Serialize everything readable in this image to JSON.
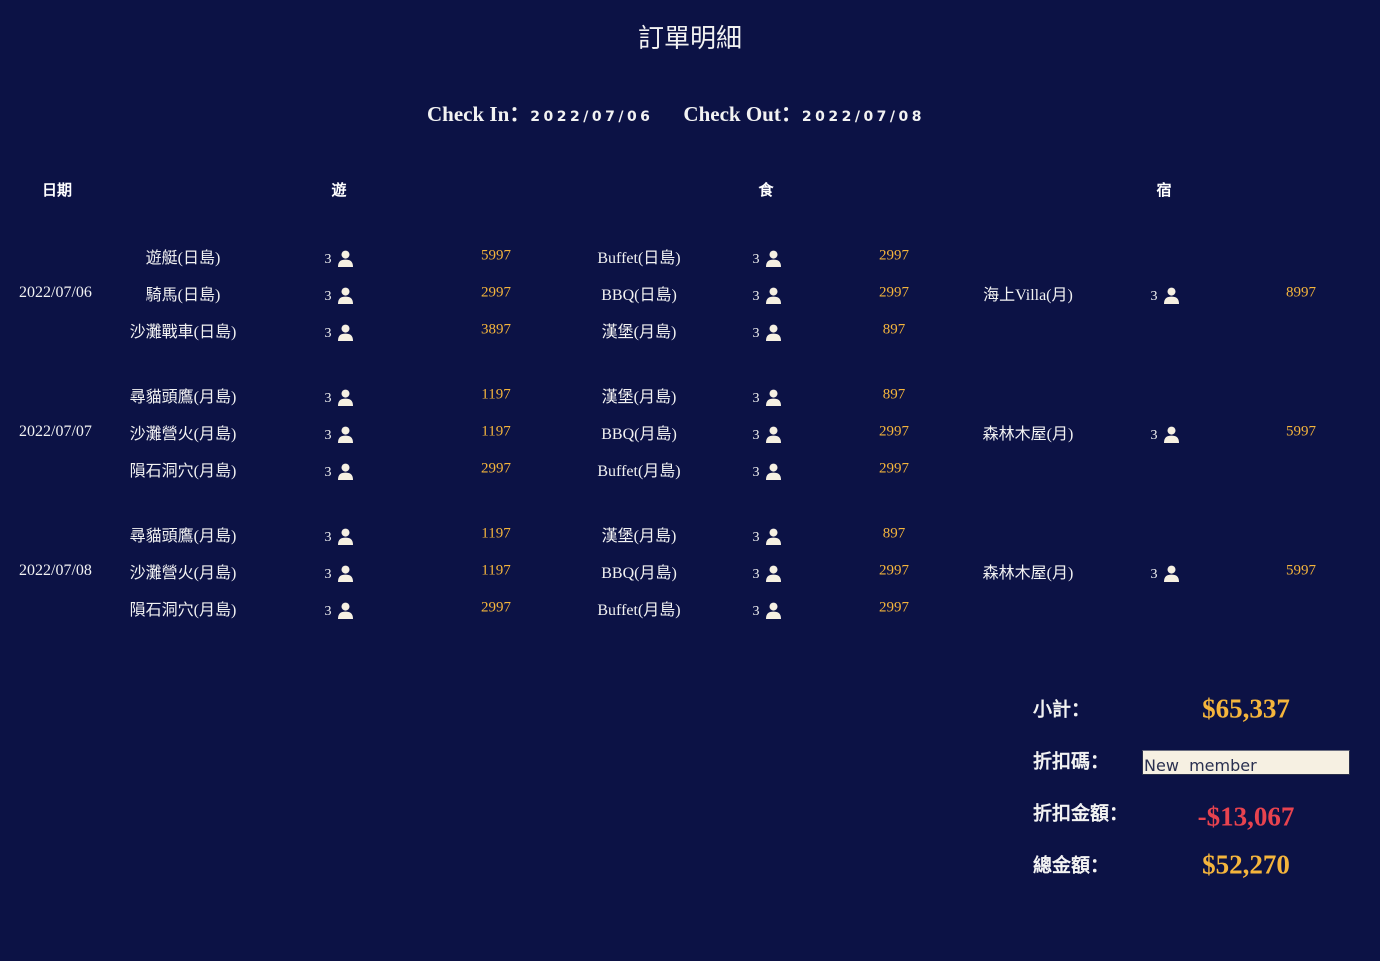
{
  "title": "訂單明細",
  "check_in": {
    "label": "Check In：",
    "value": "2022/07/06"
  },
  "check_out": {
    "label": "Check Out：",
    "value": "2022/07/08"
  },
  "headers": {
    "date": "日期",
    "play": "遊",
    "food": "食",
    "stay": "宿"
  },
  "days": [
    {
      "date": "2022/07/06",
      "play": [
        {
          "name": "遊艇(日島)",
          "qty": "3",
          "price": "5997"
        },
        {
          "name": "騎馬(日島)",
          "qty": "3",
          "price": "2997"
        },
        {
          "name": "沙灘戰車(日島)",
          "qty": "3",
          "price": "3897"
        }
      ],
      "food": [
        {
          "name": "Buffet(日島)",
          "qty": "3",
          "price": "2997"
        },
        {
          "name": "BBQ(日島)",
          "qty": "3",
          "price": "2997"
        },
        {
          "name": "漢堡(月島)",
          "qty": "3",
          "price": "897"
        }
      ],
      "stay": {
        "name": "海上Villa(月)",
        "qty": "3",
        "price": "8997"
      }
    },
    {
      "date": "2022/07/07",
      "play": [
        {
          "name": "尋貓頭鷹(月島)",
          "qty": "3",
          "price": "1197"
        },
        {
          "name": "沙灘營火(月島)",
          "qty": "3",
          "price": "1197"
        },
        {
          "name": "隕石洞穴(月島)",
          "qty": "3",
          "price": "2997"
        }
      ],
      "food": [
        {
          "name": "漢堡(月島)",
          "qty": "3",
          "price": "897"
        },
        {
          "name": "BBQ(月島)",
          "qty": "3",
          "price": "2997"
        },
        {
          "name": "Buffet(月島)",
          "qty": "3",
          "price": "2997"
        }
      ],
      "stay": {
        "name": "森林木屋(月)",
        "qty": "3",
        "price": "5997"
      }
    },
    {
      "date": "2022/07/08",
      "play": [
        {
          "name": "尋貓頭鷹(月島)",
          "qty": "3",
          "price": "1197"
        },
        {
          "name": "沙灘營火(月島)",
          "qty": "3",
          "price": "1197"
        },
        {
          "name": "隕石洞穴(月島)",
          "qty": "3",
          "price": "2997"
        }
      ],
      "food": [
        {
          "name": "漢堡(月島)",
          "qty": "3",
          "price": "897"
        },
        {
          "name": "BBQ(月島)",
          "qty": "3",
          "price": "2997"
        },
        {
          "name": "Buffet(月島)",
          "qty": "3",
          "price": "2997"
        }
      ],
      "stay": {
        "name": "森林木屋(月)",
        "qty": "3",
        "price": "5997"
      }
    }
  ],
  "summary": {
    "subtotal_label": "小計：",
    "subtotal_value": "$65,337",
    "coupon_label": "折扣碼：",
    "coupon_value": "New  member",
    "discount_label": "折扣金額：",
    "discount_value": "-$13,067",
    "total_label": "總金額：",
    "total_value": "$52,270"
  },
  "colors": {
    "background": "#0c1245",
    "price": "#f5b53c",
    "discount": "#e8434f"
  }
}
